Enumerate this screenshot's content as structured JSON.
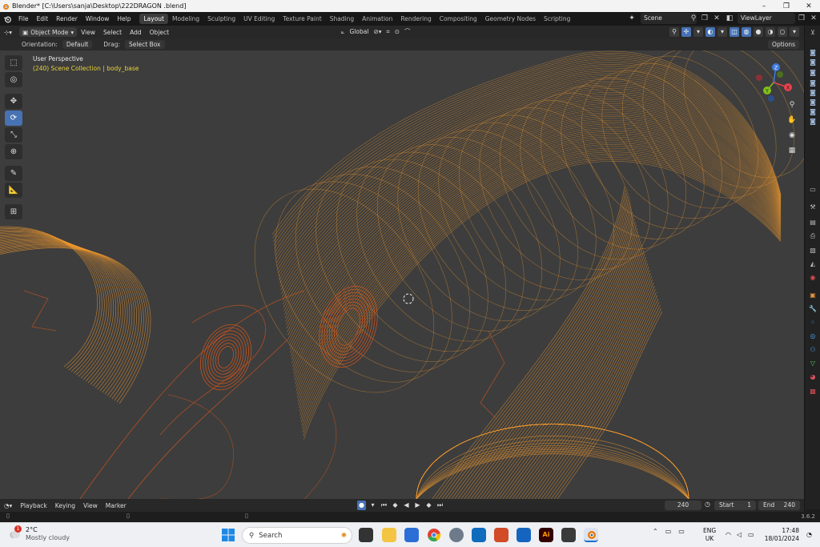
{
  "window": {
    "title": "Blender* [C:\\Users\\sanja\\Desktop\\222DRAGON .blend]",
    "minimize": "–",
    "maximize": "❐",
    "close": "✕"
  },
  "menu": [
    "File",
    "Edit",
    "Render",
    "Window",
    "Help"
  ],
  "workspaces": [
    {
      "label": "Layout",
      "active": true
    },
    {
      "label": "Modeling"
    },
    {
      "label": "Sculpting"
    },
    {
      "label": "UV Editing"
    },
    {
      "label": "Texture Paint"
    },
    {
      "label": "Shading"
    },
    {
      "label": "Animation"
    },
    {
      "label": "Rendering"
    },
    {
      "label": "Compositing"
    },
    {
      "label": "Geometry Nodes"
    },
    {
      "label": "Scripting"
    }
  ],
  "scene": {
    "name": "Scene"
  },
  "view_layer": {
    "name": "ViewLayer"
  },
  "viewport_header": {
    "mode": "Object Mode",
    "menus": [
      "View",
      "Select",
      "Add",
      "Object"
    ],
    "transform_orientation": "Global"
  },
  "tool_settings": {
    "orientation_label": "Orientation:",
    "orientation_value": "Default",
    "drag_label": "Drag:",
    "drag_value": "Select Box",
    "options": "Options"
  },
  "viewport": {
    "view_name": "User Perspective",
    "collection_info": "(240) Scene Collection | body_base",
    "wire_color": "#f29a2e",
    "wire_dark": "#d4561b"
  },
  "gizmo": {
    "x": "X",
    "y": "Y",
    "z": "Z"
  },
  "timeline": {
    "menus": [
      "Playback",
      "Keying",
      "View",
      "Marker"
    ],
    "current_frame": "240",
    "start_label": "Start",
    "start_value": "1",
    "end_label": "End",
    "end_value": "240"
  },
  "status": {
    "version": "3.6.2"
  },
  "taskbar": {
    "weather_temp": "2°C",
    "weather_desc": "Mostly cloudy",
    "notification_badge": "1",
    "search_placeholder": "Search",
    "language": "ENG",
    "region": "UK",
    "time": "17:48",
    "date": "18/01/2024"
  },
  "colors": {
    "accent_blue": "#4772b3",
    "header_bg": "#282828",
    "viewport_bg": "#3d3d3d"
  }
}
